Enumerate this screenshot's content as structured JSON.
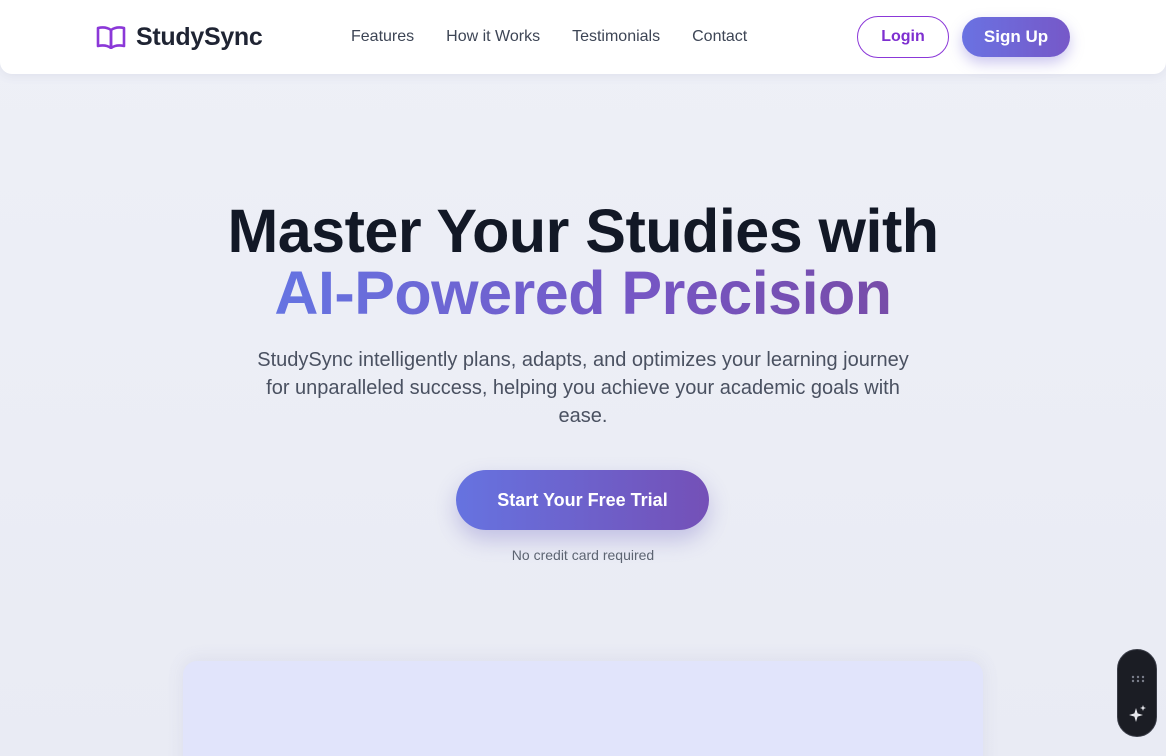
{
  "brand": {
    "name": "StudySync",
    "icon": "open-book-icon",
    "accent": "#8b38d8"
  },
  "nav": {
    "links": [
      "Features",
      "How it Works",
      "Testimonials",
      "Contact"
    ],
    "login_label": "Login",
    "signup_label": "Sign Up"
  },
  "hero": {
    "title_line1": "Master Your Studies with",
    "title_line2": "AI-Powered Precision",
    "subtitle": "StudySync intelligently plans, adapts, and optimizes your learning journey for unparalleled success, helping you achieve your academic goals with ease.",
    "cta_label": "Start Your Free Trial",
    "cta_note": "No credit card required"
  },
  "colors": {
    "gradient_start": "#6673e0",
    "gradient_end": "#7450b7",
    "heading": "#121826",
    "preview_card": "#e1e4fb"
  },
  "widget": {
    "icons": [
      "grip-icon",
      "sparkle-icon"
    ]
  }
}
